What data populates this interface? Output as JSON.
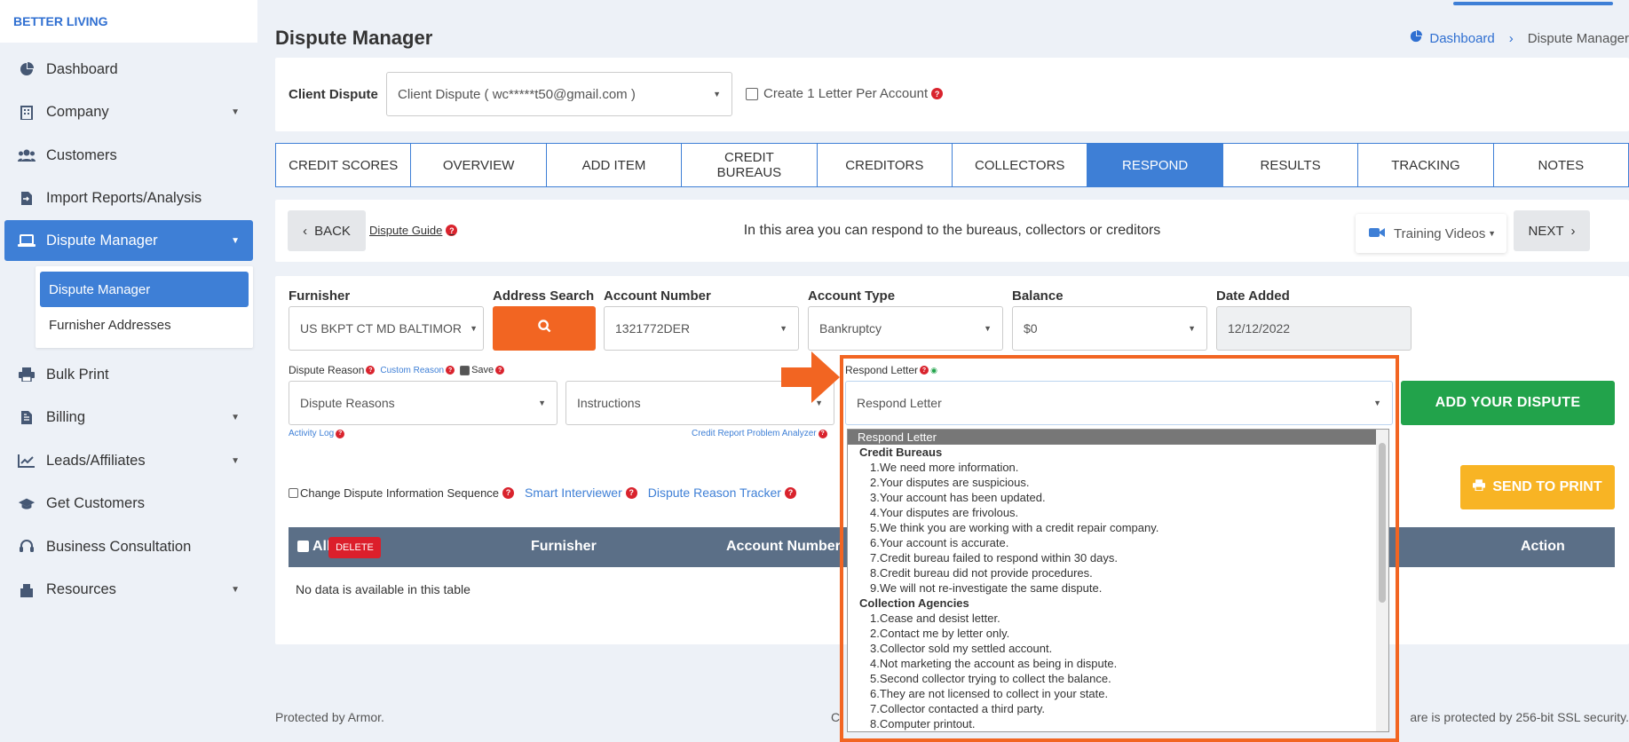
{
  "brand": "BETTER LIVING",
  "sidebar": {
    "items": [
      {
        "label": "Dashboard",
        "icon": "chart-pie-icon"
      },
      {
        "label": "Company",
        "icon": "building-icon"
      },
      {
        "label": "Customers",
        "icon": "users-icon"
      },
      {
        "label": "Import Reports/Analysis",
        "icon": "file-import-icon"
      },
      {
        "label": "Dispute Manager",
        "icon": "laptop-icon"
      },
      {
        "label": "Bulk Print",
        "icon": "printer-icon"
      },
      {
        "label": "Billing",
        "icon": "file-invoice-icon"
      },
      {
        "label": "Leads/Affiliates",
        "icon": "line-chart-icon"
      },
      {
        "label": "Get Customers",
        "icon": "graduation-cap-icon"
      },
      {
        "label": "Business Consultation",
        "icon": "headset-icon"
      },
      {
        "label": "Resources",
        "icon": "box-icon"
      }
    ],
    "submenu": [
      "Dispute Manager",
      "Furnisher Addresses"
    ]
  },
  "header": {
    "title": "Dispute Manager",
    "breadcrumb_home": "Dashboard",
    "breadcrumb_current": "Dispute Manager"
  },
  "client": {
    "label": "Client Dispute",
    "selected": "Client Dispute ( wc*****t50@gmail.com )",
    "create_one_label": "Create 1 Letter Per Account"
  },
  "tabs": [
    {
      "label": "CREDIT SCORES"
    },
    {
      "label": "OVERVIEW"
    },
    {
      "label": "ADD ITEM"
    },
    {
      "label": "CREDIT BUREAUS"
    },
    {
      "label": "CREDITORS"
    },
    {
      "label": "COLLECTORS"
    },
    {
      "label": "RESPOND"
    },
    {
      "label": "RESULTS"
    },
    {
      "label": "TRACKING"
    },
    {
      "label": "NOTES"
    }
  ],
  "action_bar": {
    "back": "BACK",
    "guide": "Dispute Guide",
    "info": "In this area you can respond to the bureaus, collectors or creditors",
    "training": "Training Videos",
    "next": "NEXT"
  },
  "form": {
    "furnisher_label": "Furnisher",
    "furnisher_value": "US BKPT CT MD BALTIMOR",
    "address_search_label": "Address Search",
    "account_number_label": "Account Number",
    "account_number_value": "1321772DER",
    "account_type_label": "Account Type",
    "account_type_value": "Bankruptcy",
    "balance_label": "Balance",
    "balance_value": "$0",
    "date_added_label": "Date Added",
    "date_added_value": "12/12/2022",
    "dispute_reason_label": "Dispute Reason",
    "custom_reason": "Custom Reason",
    "save_label": "Save",
    "dispute_reasons_value": "Dispute Reasons",
    "instructions_value": "Instructions",
    "activity_log": "Activity Log",
    "problem_analyzer": "Credit Report Problem Analyzer",
    "respond_letter_label": "Respond Letter",
    "respond_letter_value": "Respond Letter",
    "add_dispute": "ADD YOUR DISPUTE",
    "send_print": "SEND TO PRINT",
    "change_sequence": "Change Dispute Information Sequence",
    "smart_interviewer": "Smart Interviewer",
    "reason_tracker": "Dispute Reason Tracker"
  },
  "table": {
    "all": "All",
    "delete": "DELETE",
    "col_furnisher": "Furnisher",
    "col_account": "Account Number",
    "col_action": "Action",
    "empty": "No data is available in this table"
  },
  "dropdown": {
    "selected": "Respond Letter",
    "groups": [
      {
        "name": "Credit Bureaus",
        "options": [
          "1.We need more information.",
          "2.Your disputes are suspicious.",
          "3.Your account has been updated.",
          "4.Your disputes are frivolous.",
          "5.We think you are working with a credit repair company.",
          "6.Your account is accurate.",
          "7.Credit bureau failed to respond within 30 days.",
          "8.Credit bureau did not provide procedures.",
          "9.We will not re-investigate the same dispute."
        ]
      },
      {
        "name": "Collection Agencies",
        "options": [
          "1.Cease and desist letter.",
          "2.Contact me by letter only.",
          "3.Collector sold my settled account.",
          "4.Not marketing the account as being in dispute.",
          "5.Second collector trying to collect the balance.",
          "6.They are not licensed to collect in your state.",
          "7.Collector contacted a third party.",
          "8.Computer printout."
        ]
      }
    ]
  },
  "footer": {
    "left": "Protected by Armor.",
    "right_visible": "are is protected by 256-bit SSL security.",
    "center_visible": "C"
  },
  "colors": {
    "primary": "#3e7fd6",
    "orange": "#f26522",
    "green": "#22a34b",
    "yellow": "#f8b424",
    "danger": "#dc1f2b",
    "table_header": "#5b6f87"
  }
}
